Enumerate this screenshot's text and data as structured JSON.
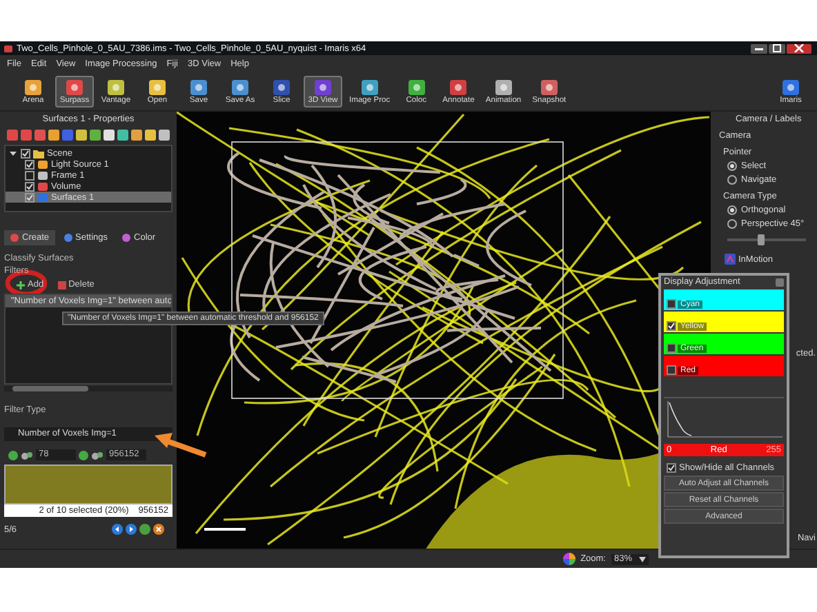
{
  "window": {
    "title": "Two_Cells_Pinhole_0_5AU_7386.ims - Two_Cells_Pinhole_0_5AU_nyquist - Imaris x64"
  },
  "menu": [
    "File",
    "Edit",
    "View",
    "Image Processing",
    "Fiji",
    "3D View",
    "Help"
  ],
  "toolbar": [
    {
      "label": "Arena",
      "selected": false
    },
    {
      "label": "Surpass",
      "selected": true
    },
    {
      "label": "Vantage",
      "selected": false
    },
    {
      "label": "Open",
      "selected": false
    },
    {
      "label": "Save",
      "selected": false
    },
    {
      "label": "Save As",
      "selected": false
    },
    {
      "label": "Slice",
      "selected": false
    },
    {
      "label": "3D View",
      "selected": true
    },
    {
      "label": "Image Proc",
      "selected": false
    },
    {
      "label": "Coloc",
      "selected": false
    },
    {
      "label": "Annotate",
      "selected": false
    },
    {
      "label": "Animation",
      "selected": false
    },
    {
      "label": "Snapshot",
      "selected": false
    },
    {
      "label": "Imaris",
      "selected": false
    }
  ],
  "left_panel": {
    "title": "Surfaces 1 - Properties",
    "tree": [
      {
        "label": "Scene",
        "checked": true,
        "expanded": true,
        "selected": false,
        "children": [
          {
            "label": "Light Source 1",
            "checked": true,
            "selected": false
          },
          {
            "label": "Frame 1",
            "checked": false,
            "selected": false
          },
          {
            "label": "Volume",
            "checked": true,
            "selected": false
          },
          {
            "label": "Surfaces 1",
            "checked": true,
            "selected": true
          }
        ]
      }
    ],
    "tabs": [
      {
        "label": "Create",
        "selected": true
      },
      {
        "label": "Settings",
        "selected": false
      },
      {
        "label": "Color",
        "selected": false
      }
    ],
    "section": "Classify Surfaces",
    "filters_label": "Filters",
    "buttons": [
      "Add",
      "Delete"
    ],
    "filters": [
      {
        "label": "\"Number of Voxels Img=1\" between auto",
        "selected": true
      }
    ],
    "tooltip": "\"Number of Voxels Img=1\" between automatic threshold and 956152",
    "filter_type_label": "Filter Type",
    "filter_type": "Number of Voxels Img=1",
    "lower": "78",
    "upper": "956152",
    "summary": "2 of 10 selected (20%)",
    "summary_max": "956152",
    "page": "5/6"
  },
  "right_panel": {
    "title": "Camera / Labels",
    "section": "Camera",
    "pointer_label": "Pointer",
    "pointer": [
      {
        "label": "Select",
        "selected": true
      },
      {
        "label": "Navigate",
        "selected": false
      }
    ],
    "camera_type_label": "Camera Type",
    "camera_type": [
      {
        "label": "Orthogonal",
        "selected": true
      },
      {
        "label": "Perspective 45°",
        "selected": false
      }
    ],
    "slider": {
      "level": 0.42
    },
    "inmotion": "InMotion",
    "fragment_1": "cted.",
    "fragment_2": "Navi"
  },
  "display_adjustment": {
    "title": "Display Adjustment",
    "channels": [
      {
        "name": "Cyan",
        "color": "#00ffff",
        "checked": false
      },
      {
        "name": "Yellow",
        "color": "#ffff00",
        "checked": true
      },
      {
        "name": "Green",
        "color": "#00ff00",
        "checked": false
      },
      {
        "name": "Red",
        "color": "#ff0000",
        "checked": false
      }
    ],
    "range_min": "0",
    "range_channel": "Red",
    "range_max": "255",
    "show_all": {
      "label": "Show/Hide all Channels",
      "checked": true
    },
    "buttons": [
      "Auto Adjust all Channels",
      "Reset all Channels",
      "Advanced"
    ]
  },
  "status_bar": {
    "zoom_label": "Zoom:",
    "zoom": "83%"
  }
}
